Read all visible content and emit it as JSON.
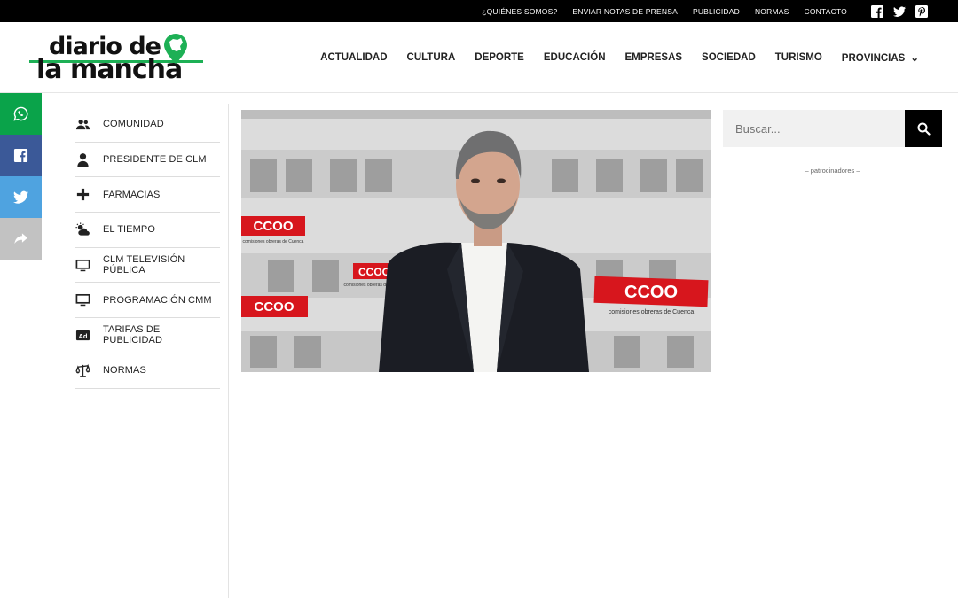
{
  "topbar": {
    "links": [
      "¿QUIÉNES SOMOS?",
      "ENVIAR NOTAS DE PRENSA",
      "PUBLICIDAD",
      "NORMAS",
      "CONTACTO"
    ],
    "social_icons": [
      "facebook-icon",
      "twitter-icon",
      "pinterest-icon"
    ]
  },
  "logo": {
    "line1": "diario de",
    "line2": "la mancha",
    "accent_color": "#1db055"
  },
  "nav": {
    "items": [
      "ACTUALIDAD",
      "CULTURA",
      "DEPORTE",
      "EDUCACIÓN",
      "EMPRESAS",
      "SOCIEDAD",
      "TURISMO",
      "PROVINCIAS"
    ]
  },
  "share_bar": [
    {
      "icon": "whatsapp-icon",
      "color": "#0aa34a"
    },
    {
      "icon": "facebook-icon",
      "color": "#3b5998"
    },
    {
      "icon": "twitter-icon",
      "color": "#4fa3e0"
    },
    {
      "icon": "share-icon",
      "color": "#c2c2c2"
    }
  ],
  "sidebar": {
    "items": [
      {
        "label": "COMUNIDAD",
        "icon": "users-icon"
      },
      {
        "label": "PRESIDENTE DE CLM",
        "icon": "user-icon"
      },
      {
        "label": "FARMACIAS",
        "icon": "plus-icon"
      },
      {
        "label": "EL TIEMPO",
        "icon": "cloud-sun-icon"
      },
      {
        "label": "CLM TELEVISIÓN PÚBLICA",
        "icon": "monitor-icon"
      },
      {
        "label": "PROGRAMACIÓN CMM",
        "icon": "monitor-icon"
      },
      {
        "label": "TARIFAS DE PUBLICIDAD",
        "icon": "ad-icon"
      },
      {
        "label": "NORMAS",
        "icon": "scale-icon"
      }
    ]
  },
  "photo": {
    "backdrop_texts": [
      "CCOO",
      "comisiones obreras de Cuenca"
    ]
  },
  "search": {
    "placeholder": "Buscar..."
  },
  "sponsor_label": "– patrocinadores –"
}
